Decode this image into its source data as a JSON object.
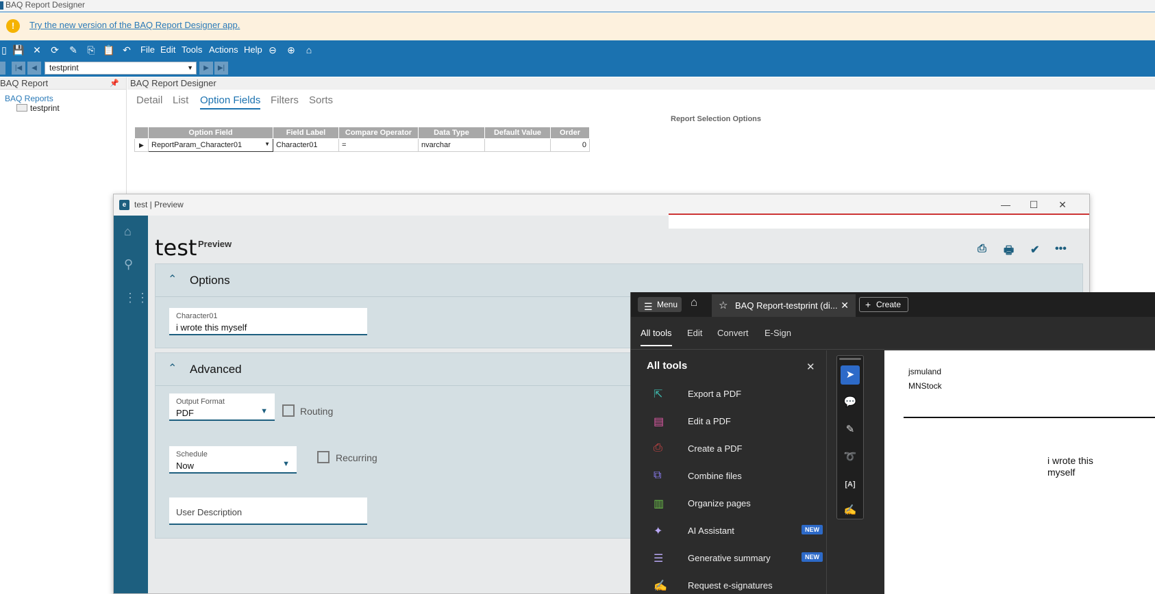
{
  "window": {
    "title": "BAQ Report Designer",
    "banner_link": "Try the new version of the BAQ Report Designer app."
  },
  "toolbar": {
    "icons": [
      "save-icon",
      "close-icon",
      "refresh-icon",
      "clear-icon",
      "copy-icon",
      "paste-icon",
      "undo-icon"
    ],
    "menus": [
      "File",
      "Edit",
      "Tools",
      "Actions",
      "Help"
    ],
    "nav_icons": [
      "back-icon",
      "forward-icon",
      "home-icon"
    ]
  },
  "navbar": {
    "record": "testprint"
  },
  "tree": {
    "header": "BAQ Report",
    "root": "BAQ Reports",
    "child": "testprint"
  },
  "main": {
    "header": "BAQ Report Designer",
    "tabs": [
      "Detail",
      "List",
      "Option Fields",
      "Filters",
      "Sorts"
    ],
    "active_tab": "Option Fields",
    "section_label": "Report Selection Options",
    "grid": {
      "columns": [
        "Option Field",
        "Field Label",
        "Compare Operator",
        "Data Type",
        "Default Value",
        "Order"
      ],
      "rows": [
        [
          "ReportParam_Character01",
          "Character01",
          "=",
          "nvarchar",
          "",
          "0"
        ]
      ]
    }
  },
  "preview": {
    "window_title": "test | Preview",
    "logo": "e",
    "title": "test",
    "subtitle": "Preview",
    "options": {
      "title": "Options",
      "field_label": "Character01",
      "field_value": "i wrote this myself"
    },
    "advanced": {
      "title": "Advanced",
      "output_format_label": "Output Format",
      "output_format_value": "PDF",
      "routing_label": "Routing",
      "schedule_label": "Schedule",
      "schedule_value": "Now",
      "recurring_label": "Recurring",
      "user_description_placeholder": "User Description"
    }
  },
  "acrobat": {
    "menu_label": "Menu",
    "doc_tab": "BAQ Report-testprint (di...",
    "create_label": "Create",
    "tabs": [
      "All tools",
      "Edit",
      "Convert",
      "E-Sign"
    ],
    "active_tab": "All tools",
    "panel_title": "All tools",
    "tools": [
      {
        "label": "Export a PDF",
        "icon": "export-pdf-icon",
        "color": "#3fb5a9",
        "new": false
      },
      {
        "label": "Edit a PDF",
        "icon": "edit-pdf-icon",
        "color": "#e05aa6",
        "new": false
      },
      {
        "label": "Create a PDF",
        "icon": "create-pdf-icon",
        "color": "#e04848",
        "new": false
      },
      {
        "label": "Combine files",
        "icon": "combine-files-icon",
        "color": "#8a7cf0",
        "new": false
      },
      {
        "label": "Organize pages",
        "icon": "organize-pages-icon",
        "color": "#6cc24a",
        "new": false
      },
      {
        "label": "AI Assistant",
        "icon": "ai-assistant-icon",
        "color": "#b9a8f5",
        "new": true
      },
      {
        "label": "Generative summary",
        "icon": "generative-summary-icon",
        "color": "#b9a8f5",
        "new": true
      },
      {
        "label": "Request e-signatures",
        "icon": "request-esign-icon",
        "color": "#c050d8",
        "new": false
      }
    ],
    "new_badge": "NEW",
    "page": {
      "line1": "jsmuland",
      "line2": "MNStock",
      "value": "i wrote this myself"
    }
  }
}
